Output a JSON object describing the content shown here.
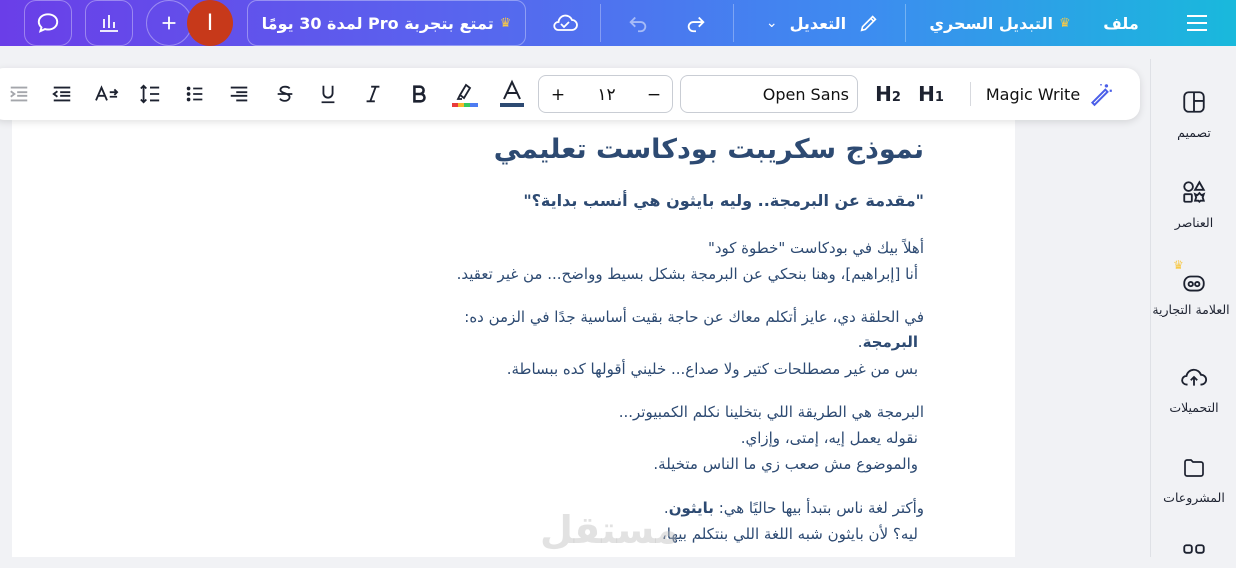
{
  "topbar": {
    "menu_file": "ملف",
    "magic_switch": "التبديل السحري",
    "edit": "التعديل",
    "pro_trial": "تمتع بتجربة Pro لمدة 30 يومًا",
    "avatar_letter": "I"
  },
  "toolbar": {
    "magic_write": "Magic Write",
    "h1": "H1",
    "h2": "H2",
    "font_name": "Open Sans",
    "font_size": "١٢",
    "minus": "−",
    "plus": "+"
  },
  "right_panel": {
    "items": [
      {
        "label": "تصميم"
      },
      {
        "label": "العناصر"
      },
      {
        "label": "العلامة التجارية"
      },
      {
        "label": "التحميلات"
      },
      {
        "label": "المشروعات"
      }
    ]
  },
  "document": {
    "title": "نموذج سكريبت بودكاست تعليمي",
    "subtitle": "\"مقدمة عن البرمجة.. وليه بايثون هي أنسب بداية؟\"",
    "p1_line1": "أهلاً بيك في بودكاست \"خطوة كود\"",
    "p1_line2": "أنا [إبراهيم]، وهنا بنحكي عن البرمجة بشكل بسيط وواضح... من غير تعقيد.",
    "p2_line1": "في الحلقة دي، عايز أتكلم معاك عن حاجة بقيت أساسية جدًا في الزمن ده:",
    "p2_bold": "البرمجة",
    "p2_dot": ".",
    "p2_line3": "بس من غير مصطلحات كتير ولا صداع... خليني أقولها كده ببساطة.",
    "p3_line1": "البرمجة هي الطريقة اللي بتخلينا نكلم الكمبيوتر...",
    "p3_line2": "نقوله يعمل إيه، إمتى، وإزاي.",
    "p3_line3": "والموضوع مش صعب زي ما الناس متخيلة.",
    "p4_line1_pre": "وأكتر لغة ناس بتبدأ بيها حاليًا هي: ",
    "p4_bold": "بايثون",
    "p4_dot": ".",
    "p4_line2": "ليه؟ لأن بايثون شبه اللغة اللي بنتكلم بيها،"
  },
  "watermark": "مستقل"
}
